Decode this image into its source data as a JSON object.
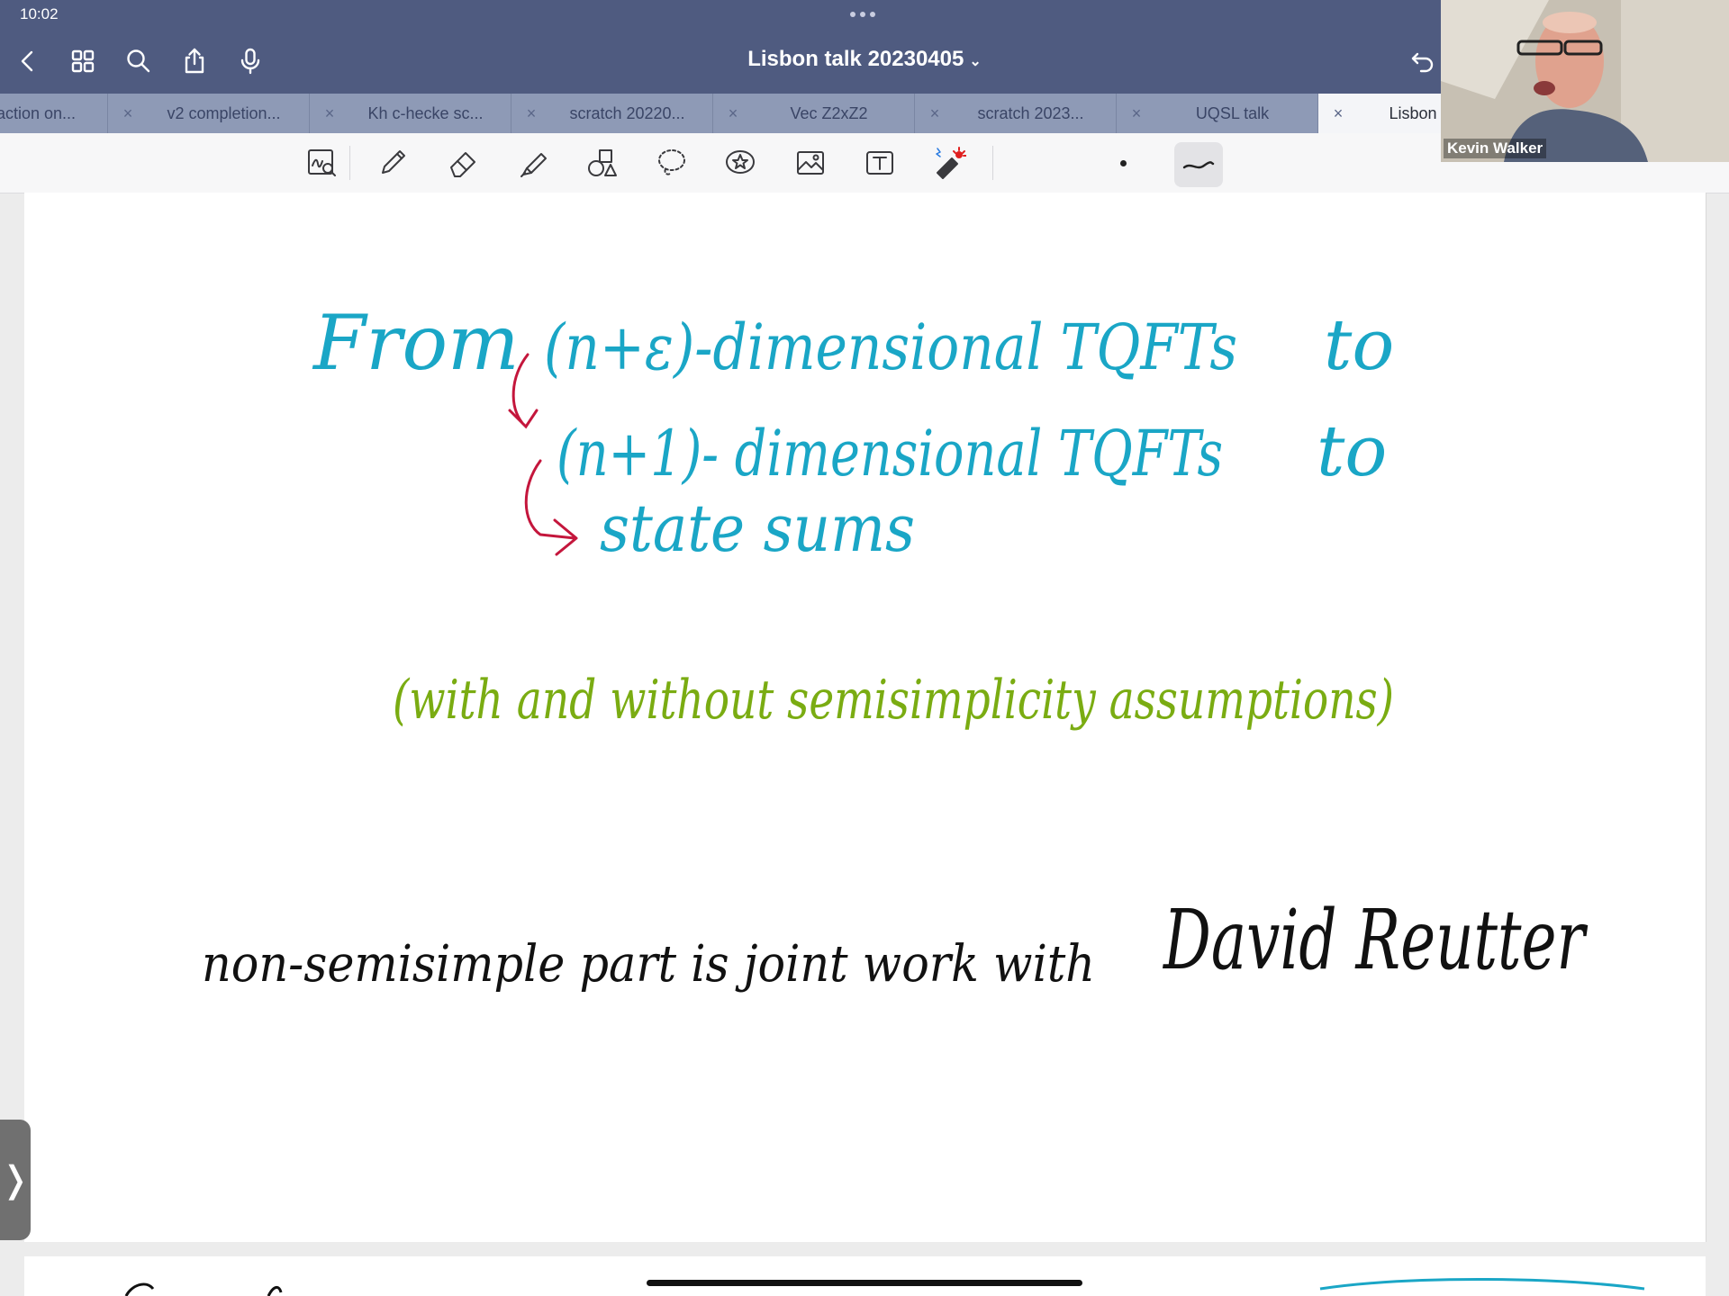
{
  "status": {
    "time": "10:02"
  },
  "header": {
    "title": "Lisbon talk 20230405",
    "title_chevron": "⌄"
  },
  "tabs": [
    {
      "label": "action on..."
    },
    {
      "label": "v2 completion..."
    },
    {
      "label": "Kh c-hecke sc..."
    },
    {
      "label": "scratch 20220..."
    },
    {
      "label": "Vec Z2xZ2"
    },
    {
      "label": "scratch 2023..."
    },
    {
      "label": "UQSL talk"
    },
    {
      "label": "Lisbon"
    }
  ],
  "tab_close_glyph": "×",
  "toolbar": {
    "tools": [
      "zoom-window-icon",
      "pen-icon",
      "eraser-icon",
      "highlighter-icon",
      "shapes-icon",
      "lasso-icon",
      "sticker-icon",
      "image-icon",
      "text-tool-icon",
      "laser-pointer-icon"
    ]
  },
  "webcam": {
    "name": "Kevin Walker"
  },
  "notes": {
    "line1_from": "From",
    "line1_main": "(n+ε)-dimensional TQFTs",
    "line1_to": "to",
    "line2_main": "(n+1)- dimensional TQFTs",
    "line2_to": "to",
    "line3": "state sums",
    "line4": "(with and without semisimplicity assumptions)",
    "line5_a": "non-semisimple part is joint work with",
    "line5_b": "David Reutter"
  },
  "colors": {
    "header_bg": "#4f5b80",
    "ink_blue": "#1aa6c6",
    "ink_red": "#c4163c",
    "ink_green": "#7aac12",
    "ink_black": "#111111"
  },
  "side_handle_glyph": "❭"
}
